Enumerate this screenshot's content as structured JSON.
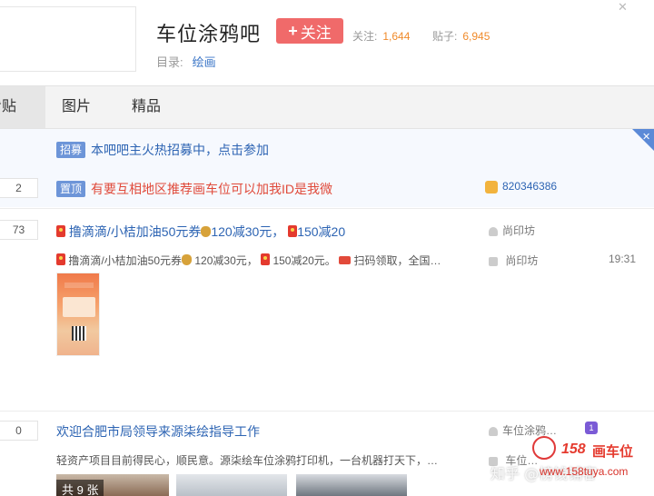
{
  "header": {
    "forum_title": "车位涂鸦吧",
    "follow_label": "关注",
    "follow_plus": "+",
    "followers_label": "关注:",
    "followers_count": "1,644",
    "posts_label": "贴子:",
    "posts_count": "6,945",
    "catalog_label": "目录:",
    "catalog_value": "绘画"
  },
  "tabs": [
    {
      "label": "看贴",
      "active": true
    },
    {
      "label": "图片",
      "active": false
    },
    {
      "label": "精品",
      "active": false
    }
  ],
  "notices": [
    {
      "tag": "招募",
      "text": "本吧吧主火热招募中，点击参加"
    },
    {
      "tag": "置顶",
      "text": "有要互相地区推荐画车位可以加我ID是我微",
      "reply_count": "2",
      "author": "820346386"
    }
  ],
  "posts": [
    {
      "reply_count": "73",
      "title_parts": [
        "撸滴滴/小桔加油50元券",
        "120减30元，",
        "150减20"
      ],
      "abstract_parts": [
        "撸滴滴/小桔加油50元券",
        "120减30元，",
        "150减20元。",
        "扫码领取，全国…"
      ],
      "author": "尚印坊",
      "last_reply_author": "尚印坊",
      "time": "19:31"
    },
    {
      "reply_count": "0",
      "title": "欢迎合肥市局领导来源柒绘指导工作",
      "abstract": "轻资产项目目前得民心，顺民意。源柒绘车位涂鸦打印机，一台机器打天下，…",
      "author": "车位涂鸦…",
      "last_reply_author": "车位…",
      "photo_count_label": "共 9 张"
    }
  ],
  "watermark": {
    "zhihu": "知乎 @榜钱铺客",
    "logo_number": "158",
    "logo_text": "画车位",
    "logo_url": "www.158tuya.com"
  },
  "colors": {
    "accent_red": "#f06a6a",
    "link_blue": "#2d64b3",
    "count_orange": "#f08a2a",
    "tag_blue": "#6d95d8"
  }
}
